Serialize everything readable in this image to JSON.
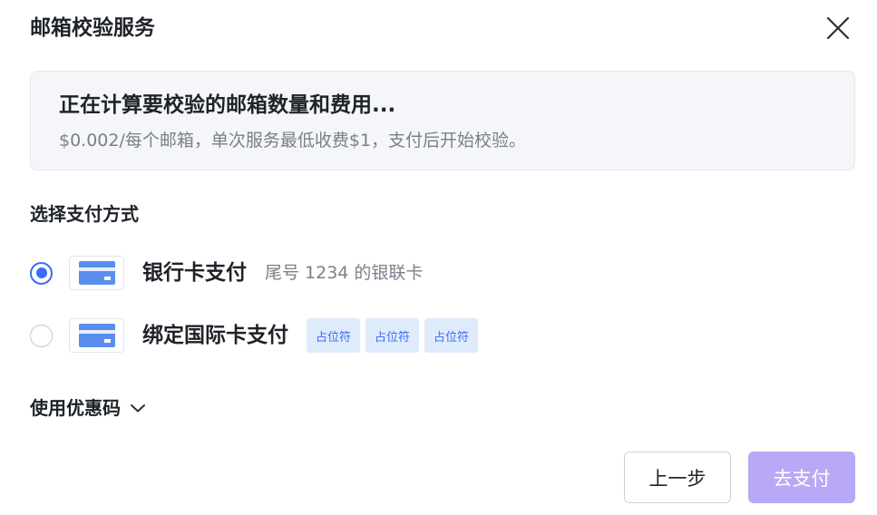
{
  "dialog": {
    "title": "邮箱校验服务",
    "close_icon": "close-icon"
  },
  "info": {
    "title": "正在计算要校验的邮箱数量和费用...",
    "description": "$0.002/每个邮箱，单次服务最低收费$1，支付后开始校验。"
  },
  "payment": {
    "section_label": "选择支付方式",
    "options": [
      {
        "label": "银行卡支付",
        "sub": "尾号 1234 的银联卡",
        "selected": true,
        "icon": "credit-card-icon"
      },
      {
        "label": "绑定国际卡支付",
        "tags": [
          "占位符",
          "占位符",
          "占位符"
        ],
        "selected": false,
        "icon": "credit-card-icon"
      }
    ]
  },
  "coupon": {
    "label": "使用优惠码",
    "icon": "chevron-down-icon"
  },
  "footer": {
    "prev_label": "上一步",
    "pay_label": "去支付"
  },
  "colors": {
    "primary": "#3b6cf6",
    "pay_button": "#b8a8f5",
    "card_icon": "#5b8def",
    "tag_bg": "#deebfb"
  }
}
